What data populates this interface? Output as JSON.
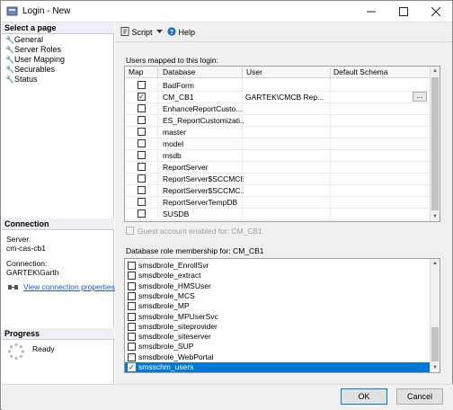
{
  "window": {
    "title": "Login - New"
  },
  "left": {
    "select_page": "Select a page",
    "pages": [
      "General",
      "Server Roles",
      "User Mapping",
      "Securables",
      "Status"
    ],
    "connection_header": "Connection",
    "server_label": "Server:",
    "server_value": "cm-cas-cb1",
    "connection_label": "Connection:",
    "connection_value": "GARTEK\\Garth",
    "view_link": "View connection properties",
    "progress_header": "Progress",
    "progress_status": "Ready"
  },
  "toolbar": {
    "script_label": "Script",
    "help_label": "Help"
  },
  "users": {
    "section_label": "Users mapped to this login:",
    "columns": [
      "Map",
      "Database",
      "User",
      "Default Schema"
    ],
    "rows": [
      {
        "checked": false,
        "database": "BadForm",
        "user": "",
        "schema": ""
      },
      {
        "checked": true,
        "database": "CM_CB1",
        "user": "GARTEK\\CMCB Rep...",
        "schema": "..."
      },
      {
        "checked": false,
        "database": "EnhanceReportCusto...",
        "user": "",
        "schema": ""
      },
      {
        "checked": false,
        "database": "ES_ReportCustomizati...",
        "user": "",
        "schema": ""
      },
      {
        "checked": false,
        "database": "master",
        "user": "",
        "schema": ""
      },
      {
        "checked": false,
        "database": "model",
        "user": "",
        "schema": ""
      },
      {
        "checked": false,
        "database": "msdb",
        "user": "",
        "schema": ""
      },
      {
        "checked": false,
        "database": "ReportServer",
        "user": "",
        "schema": ""
      },
      {
        "checked": false,
        "database": "ReportServer$SCCMCB",
        "user": "",
        "schema": ""
      },
      {
        "checked": false,
        "database": "ReportServer$SCCMC...",
        "user": "",
        "schema": ""
      },
      {
        "checked": false,
        "database": "ReportServerTempDB",
        "user": "",
        "schema": ""
      },
      {
        "checked": false,
        "database": "SUSDB",
        "user": "",
        "schema": ""
      }
    ],
    "guest_label": "Guest account enabled for: CM_CB1"
  },
  "roles": {
    "section_label": "Database role membership for: CM_CB1",
    "items": [
      {
        "checked": false,
        "name": "smsdbrole_EnrollSvr"
      },
      {
        "checked": false,
        "name": "smsdbrole_extract"
      },
      {
        "checked": false,
        "name": "smsdbrole_HMSUser"
      },
      {
        "checked": false,
        "name": "smsdbrole_MCS"
      },
      {
        "checked": false,
        "name": "smsdbrole_MP"
      },
      {
        "checked": false,
        "name": "smsdbrole_MPUserSvc"
      },
      {
        "checked": false,
        "name": "smsdbrole_siteprovider"
      },
      {
        "checked": false,
        "name": "smsdbrole_siteserver"
      },
      {
        "checked": false,
        "name": "smsdbrole_SUP"
      },
      {
        "checked": false,
        "name": "smsdbrole_WebPortal"
      },
      {
        "checked": true,
        "name": "smsschm_users",
        "selected": true
      }
    ]
  },
  "footer": {
    "ok_label": "OK",
    "cancel_label": "Cancel"
  },
  "colors": {
    "selection": "#0078d7",
    "link": "#1a57c8",
    "panel_header": "#eef0f5"
  }
}
